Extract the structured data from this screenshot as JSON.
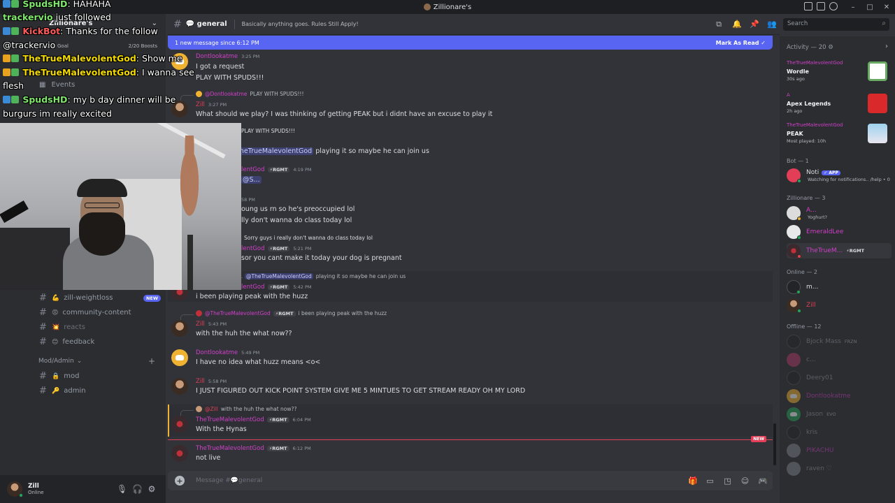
{
  "window": {
    "title": "Zillionare's",
    "controls": [
      "minimize",
      "maximize",
      "close"
    ]
  },
  "server": {
    "name": "Zillionare's",
    "boost_goal": "Boost Goal",
    "boost_count": "2/20 Boosts",
    "events_label": "Events"
  },
  "overlay": {
    "lines": [
      {
        "user": "SpudsHD",
        "text": ": HAHAHA"
      },
      {
        "user": "trackervio",
        "text": " just followed"
      },
      {
        "user": "KickBot",
        "text": ": Thanks for the follow"
      },
      {
        "user": "",
        "text": "@trackervio"
      },
      {
        "user": "TheTrueMalevolentGod",
        "text": ": Show me"
      },
      {
        "user": "TheTrueMalevolentGod",
        "text": ": I wanna see"
      },
      {
        "user": "",
        "text": "flesh"
      },
      {
        "user": "SpudsHD",
        "text": ": my b day dinner will be"
      },
      {
        "user": "",
        "text": "burgurs im really excited"
      }
    ]
  },
  "channels": [
    {
      "emoji": "💪",
      "name": "zill-weightloss",
      "badge": "NEW"
    },
    {
      "emoji": "😡",
      "name": "community-content",
      "badge": ""
    },
    {
      "emoji": "💥",
      "name": "reacts",
      "badge": ""
    },
    {
      "emoji": "😊",
      "name": "feedback",
      "badge": ""
    }
  ],
  "mod_category": "Mod/Admin",
  "mod_channels": [
    {
      "emoji": "🔒",
      "name": "mod"
    },
    {
      "emoji": "🔑",
      "name": "admin"
    }
  ],
  "user_panel": {
    "name": "Zill",
    "status": "Online"
  },
  "chat": {
    "channel": "general",
    "topic": "Basically anything goes. Rules Still Apply!",
    "new_since": "1 new message since 6:12 PM",
    "mark_read": "Mark As Read",
    "new_tag": "NEW",
    "composer_placeholder": "Message #💬general"
  },
  "messages": [
    {
      "user": "Dontlookatme",
      "time": "3:25 PM",
      "lines": [
        "I got a request",
        "PLAY WITH SPUDS!!!"
      ]
    },
    {
      "reply_user": "@Dontlookatme",
      "reply_text": "PLAY WITH SPUDS!!!",
      "user": "Zill",
      "time": "3:27 PM",
      "lines": [
        "What should we play? I was thinking of getting PEAK but i didnt have an excuse to play it"
      ]
    },
    {
      "reply_text": "PLAY WITH SPUDS!!!"
    },
    {
      "mention": "TheTrueMalevolentGod",
      "text": " playing it so maybe he can join us"
    },
    {
      "user": "lentGod",
      "badge": "⚡RGMT",
      "time": "4:19 PM",
      "mention2": "@S..."
    },
    {
      "time": "58 PM",
      "lines": [
        "oung us rn so he's preoccupied lol",
        "lly don't wanna do class today lol"
      ]
    },
    {
      "reply_text": "Sorry guys i really don't wanna do class today lol"
    },
    {
      "user": "lentGod",
      "badge": "⚡RGMT",
      "time": "5:21 PM",
      "lines": [
        "sor you cant make it today your dog is pregnant"
      ]
    },
    {
      "reply_mention": "@TheTrueMalevolentGod",
      "reply_text": "playing it so maybe he can join us"
    },
    {
      "user": "lentGod",
      "badge": "⚡RGMT",
      "time": "5:42 PM",
      "lines": [
        "i been playing peak with the huzz"
      ]
    },
    {
      "reply_user": "@TheTrueMalevolentGod",
      "reply_badge": "⚡RGMT",
      "reply_text": "i been playing peak with the huzz",
      "user": "Zill",
      "time": "5:43 PM",
      "lines": [
        "with the huh the what now??"
      ]
    },
    {
      "user": "Dontlookatme",
      "time": "5:49 PM",
      "lines": [
        "I have no idea what huzz means <o<"
      ]
    },
    {
      "user": "Zill",
      "time": "5:58 PM",
      "lines": [
        "I JUST FIGURED OUT KICK POINT SYSTEM GIVE ME 5 MINTUES TO GET STREAM READY OH MY LORD"
      ]
    },
    {
      "reply_user": "@Zill",
      "reply_text": "with the huh the what now??",
      "user": "TheTrueMalevolentGod",
      "badge": "⚡RGMT",
      "time": "6:04 PM",
      "lines": [
        "With the Hynas"
      ]
    },
    {
      "user": "TheTrueMalevolentGod",
      "badge": "⚡RGMT",
      "time": "6:12 PM",
      "lines": [
        "not live"
      ]
    }
  ],
  "search": {
    "placeholder": "Search"
  },
  "members": {
    "activity_header": "Activity — 20",
    "activities": [
      {
        "user": "TheTrueMalevolentGod",
        "game": "Wordle",
        "meta": "30s ago"
      },
      {
        "user": "A",
        "game": "Apex Legends",
        "meta": "2h ago"
      },
      {
        "user": "TheTrueMalevolentGod",
        "game": "PEAK",
        "meta": "Most played: 10h"
      }
    ],
    "bot_header": "Bot — 1",
    "bot": {
      "name": "Noti",
      "badge": "✓ APP",
      "status": "Watching for notifications.. /help • 0"
    },
    "role_header": "Zillionare — 3",
    "role_members": [
      {
        "name": "A...",
        "status": "Yoghurt?"
      },
      {
        "name": "EmeraldLee",
        "status": ""
      },
      {
        "name": "TheTrueM...",
        "tag": "⚡RGMT"
      }
    ],
    "online_header": "Online — 2",
    "online": [
      {
        "name": "m..."
      },
      {
        "name": "Zill"
      }
    ],
    "offline_header": "Offline — 12",
    "offline": [
      {
        "name": "Bjock Mass",
        "tag": "FRZN"
      },
      {
        "name": "c..."
      },
      {
        "name": "Deery01"
      },
      {
        "name": "Dontlookatme"
      },
      {
        "name": "Jason",
        "tag": "EVO"
      },
      {
        "name": "kris"
      },
      {
        "name": "PIKACHU"
      },
      {
        "name": "raven ♡"
      }
    ]
  },
  "colors": {
    "accent": "#5865f2",
    "username_pink": "#d040c8",
    "username_red": "#e23e57",
    "bg_chat": "#313338",
    "bg_sidebar": "#2b2d31"
  }
}
